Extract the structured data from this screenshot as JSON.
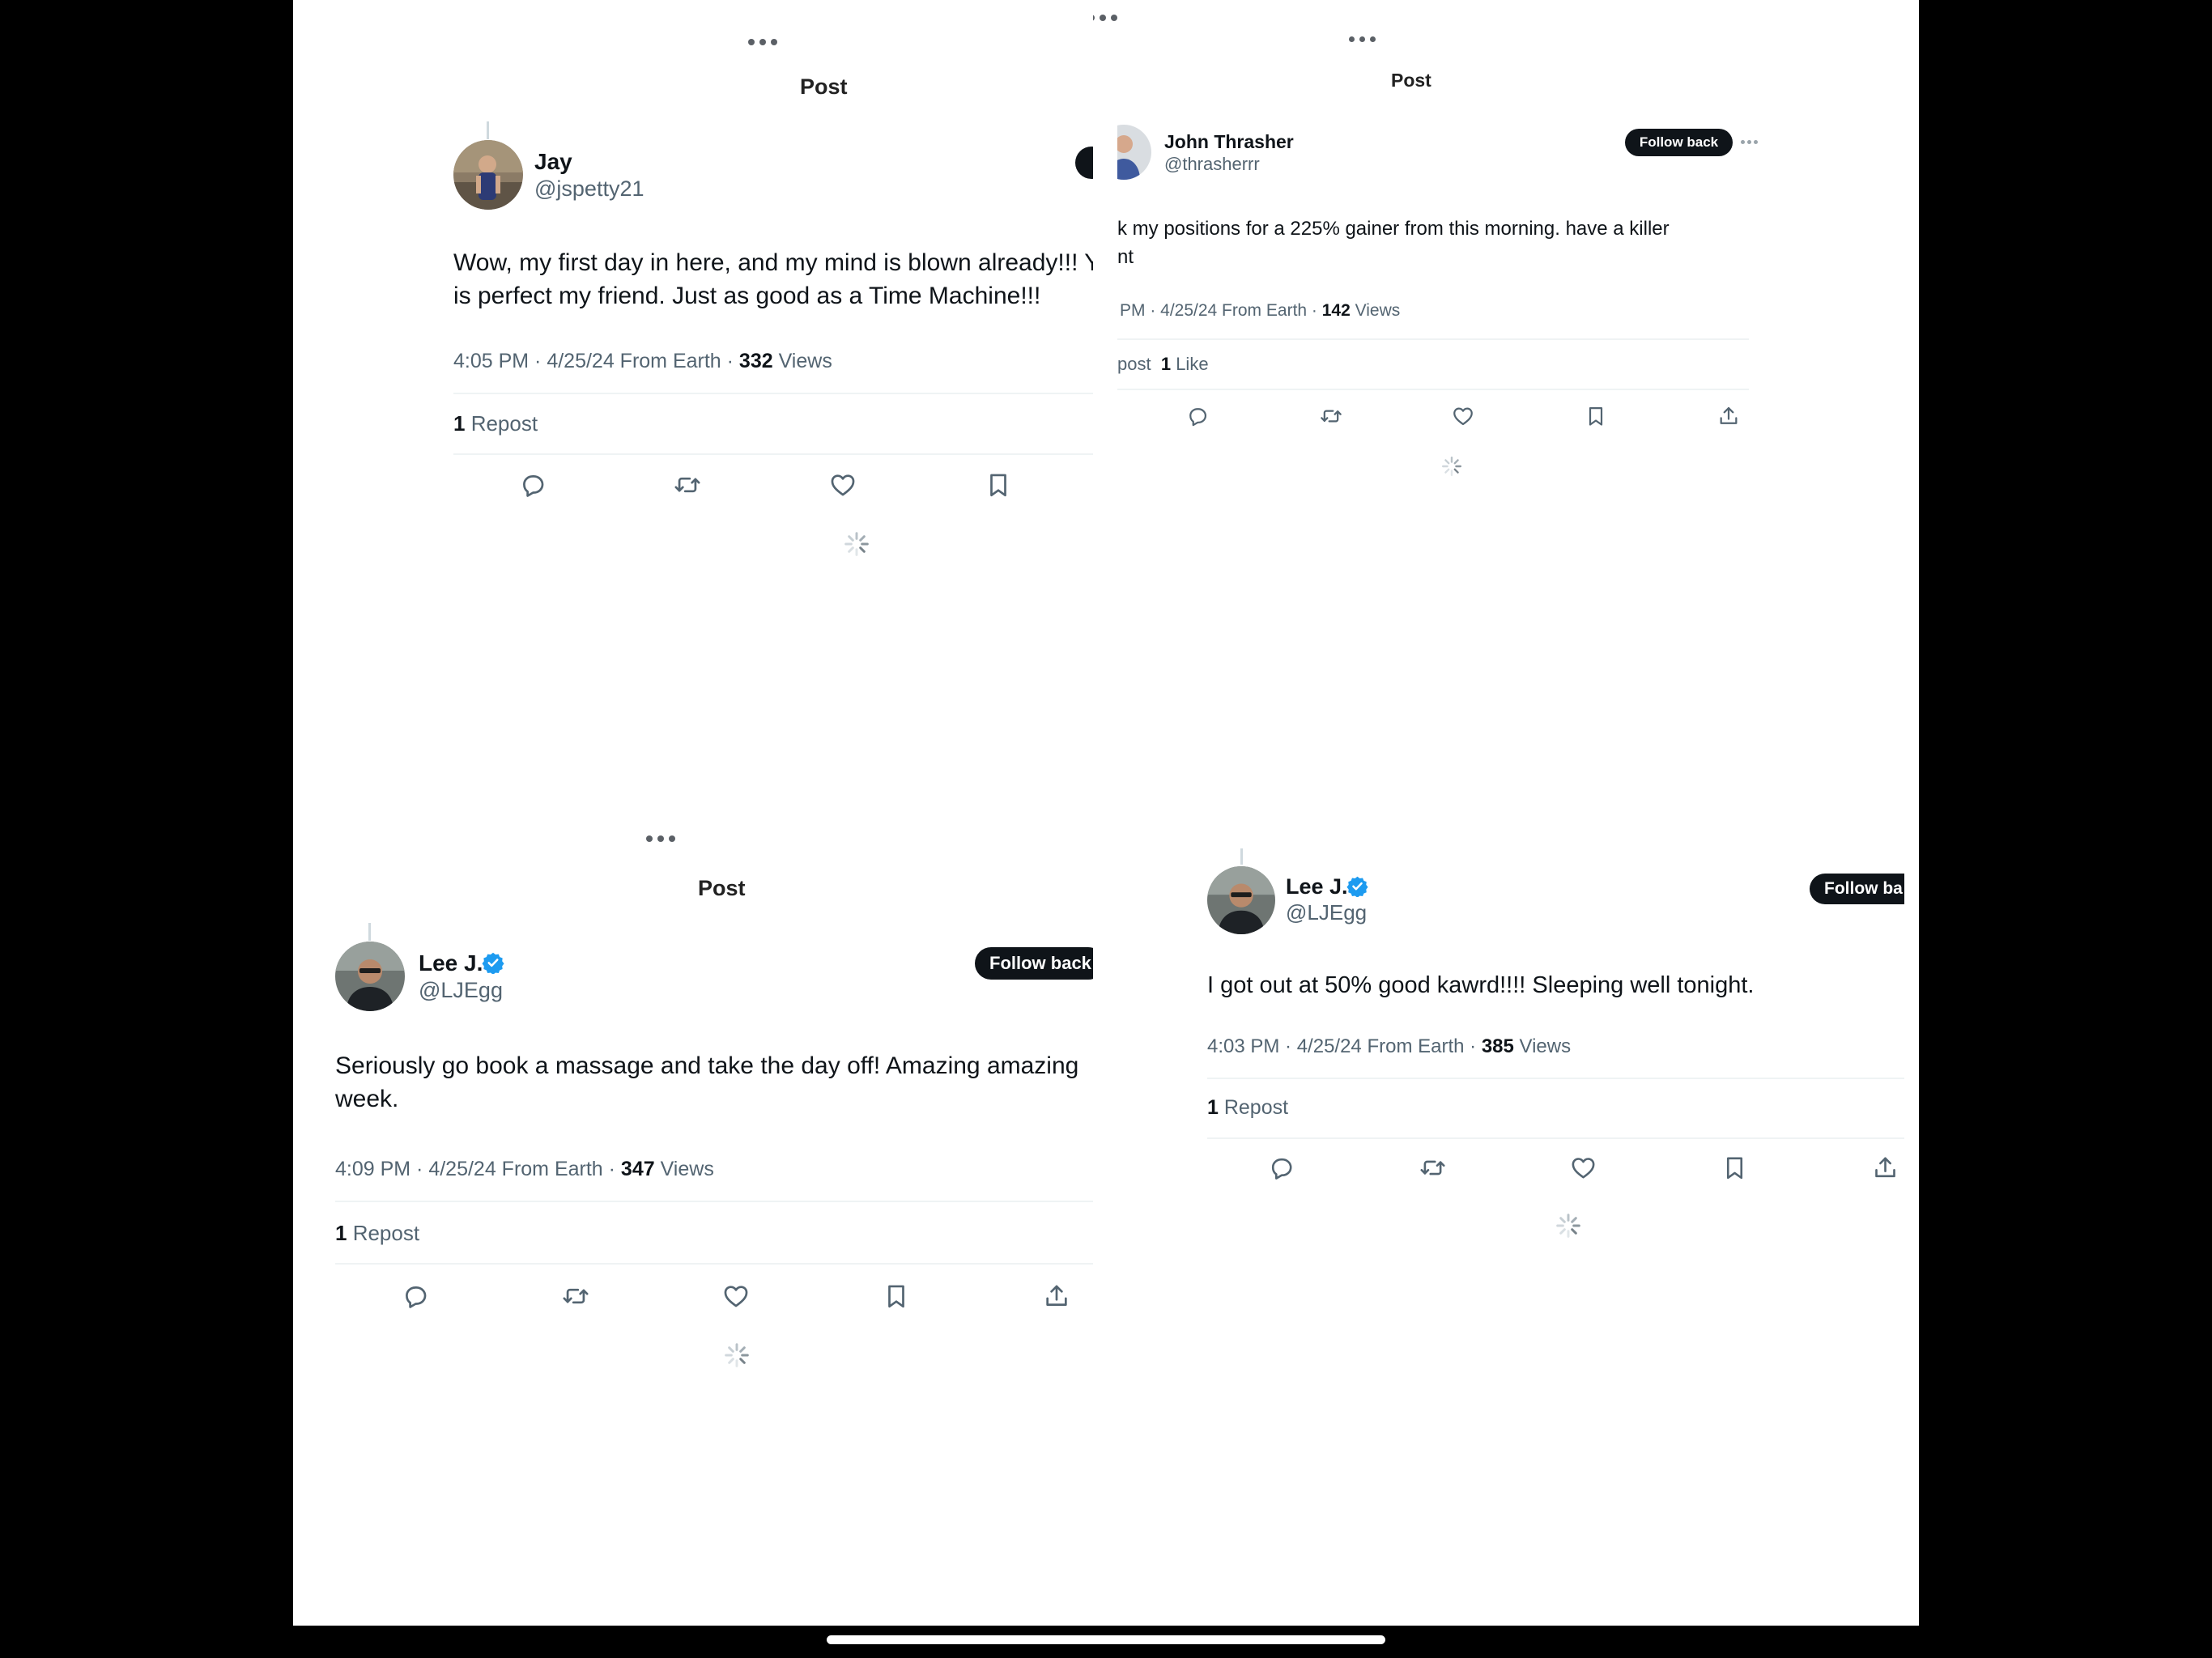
{
  "page": {
    "top_menu": "more-options",
    "home_indicator": "home-indicator"
  },
  "colors": {
    "verified_blue": "#1d9bf0",
    "text_primary": "#0f1419",
    "text_secondary": "#536471",
    "button_dark": "#0f1419"
  },
  "panels": [
    {
      "header_title": "Post",
      "author": {
        "name": "Jay",
        "handle": "@jspetty21"
      },
      "text_line1": "Wow, my first day in here, and my mind is blown already!!! Y",
      "text_line2": "is perfect my friend.  Just as good  as a Time Machine!!!",
      "meta_prefix": "4:05 PM · 4/25/24 From Earth · ",
      "views_count": "332",
      "views_label": " Views",
      "repost_count": "1",
      "repost_label": " Repost"
    },
    {
      "header_title": "Post",
      "author": {
        "name": "John Thrasher",
        "handle": "@thrasherrr"
      },
      "follow_label": "Follow back",
      "text_line1": "k my positions for a 225% gainer from this morning.  have a killer",
      "text_line2": "nt",
      "meta_prefix": "PM · 4/25/24 From Earth · ",
      "views_count": "142",
      "views_label": " Views",
      "repost_label": "post",
      "like_count": "1",
      "like_label": " Like"
    },
    {
      "header_title": "Post",
      "author": {
        "name": "Lee J.",
        "handle": "@LJEgg"
      },
      "follow_label": "Follow back",
      "text_line1": "Seriously go book a massage and take the day off! Amazing amazing",
      "text_line2": "week.",
      "meta_prefix": "4:09 PM · 4/25/24 From Earth · ",
      "views_count": "347",
      "views_label": " Views",
      "repost_count": "1",
      "repost_label": " Repost"
    },
    {
      "author": {
        "name": "Lee J.",
        "handle": "@LJEgg"
      },
      "follow_label": "Follow ba",
      "text_line1": "I got out at 50% good kawrd!!!! Sleeping well tonight.",
      "meta_prefix": "4:03 PM · 4/25/24 From Earth · ",
      "views_count": "385",
      "views_label": " Views",
      "repost_count": "1",
      "repost_label": " Repost"
    }
  ],
  "action_icons": [
    "reply-icon",
    "repost-icon",
    "like-icon",
    "bookmark-icon",
    "share-icon"
  ],
  "loading_icon": "loading-spinner-icon"
}
